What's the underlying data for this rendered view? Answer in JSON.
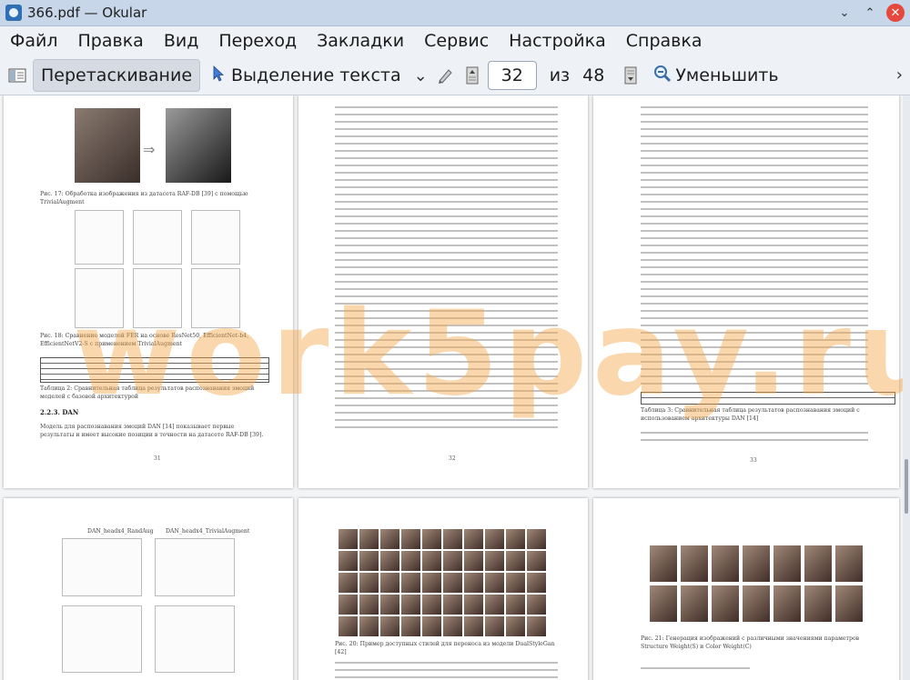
{
  "window": {
    "title": "366.pdf — Okular",
    "buttons": {
      "collapse": "⌄",
      "minimize": "⌃",
      "close": "✕"
    }
  },
  "menu": [
    "Файл",
    "Правка",
    "Вид",
    "Переход",
    "Закладки",
    "Сервис",
    "Настройка",
    "Справка"
  ],
  "toolbar": {
    "browse_label": "Перетаскивание",
    "select_label": "Выделение текста",
    "current_page": "32",
    "of_label": "из",
    "total_pages": "48",
    "zoom_out_label": "Уменьшить",
    "more_arrow": "›",
    "dropdown_chevron": "⌄"
  },
  "watermark": "work5pay.ru",
  "pages": {
    "p31": {
      "caption_17": "Рис. 17: Обработка изображения из датасета RAF-DB [39] с помощью TrivialAugment",
      "caption_18": "Рис. 18: Сравнение моделей FER на основе ResNet50, EfficientNet-b4, EfficientNetV2-S с применением TrivialAugment",
      "table_2": "Таблица 2: Сравнительная таблица результатов распознавания эмоций моделей с базовой архитектурой",
      "section": "2.2.3.  DAN",
      "para": "Модель для распознавания эмоций DAN [14] показывает первые результаты и имеет высокие позиции в точности на датасете RAF-DB [39].",
      "number": "31"
    },
    "p32": {
      "number": "32",
      "caption_20": "Рис. 20: Пример доступных стилей для переноса из модели DualStyleGan [42]"
    },
    "p33": {
      "number": "33",
      "table_3": "Таблица 3: Сравнительная таблица результатов распознавания эмоций с использованием архитектуры DAN [14]",
      "caption_21": "Рис. 21: Генерация изображений с различными значениями параметров Structure Weight(S) и Color Weight(C)"
    },
    "p34": {
      "plot_a_title": "DAN_headx4_RandAug",
      "plot_b_title": "DAN_headx4_TrivialAugment"
    }
  }
}
